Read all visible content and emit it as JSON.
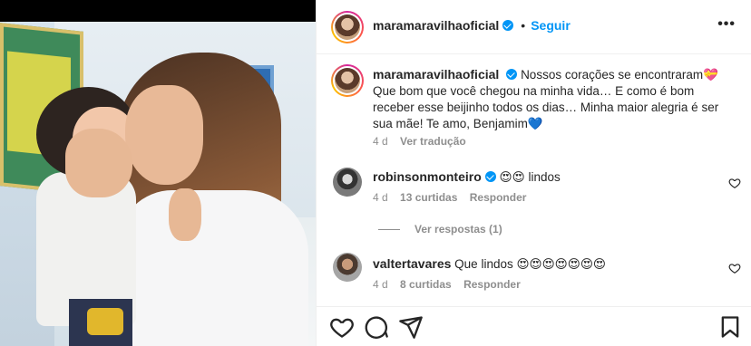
{
  "post": {
    "username": "maramaravilhaoficial",
    "follow_label": "Seguir",
    "more_label": "•••",
    "caption_text": "Nossos corações se encontraram💝 Que bom que você chegou na minha vida… E como é bom receber esse beijinho todos os dias… Minha maior alegria é ser sua mãe! Te amo, Benjamim💙",
    "caption_time": "4 d",
    "translate_label": "Ver tradução"
  },
  "comments": [
    {
      "username": "robinsonmonteiro",
      "emojis": "😍😍",
      "text": "lindos",
      "time": "4 d",
      "likes": "13 curtidas",
      "reply": "Responder"
    },
    {
      "username": "valtertavares",
      "text": "Que lindos 😍😍😍😍😍😍😍",
      "time": "4 d",
      "likes": "8 curtidas",
      "reply": "Responder"
    }
  ],
  "view_replies_label": "Ver respostas (1)",
  "icons": {
    "like": "heart-icon",
    "comment": "comment-icon",
    "share": "send-icon",
    "save": "bookmark-icon"
  },
  "colors": {
    "accent": "#0095f6",
    "text": "#262626",
    "muted": "#8e8e8e"
  }
}
